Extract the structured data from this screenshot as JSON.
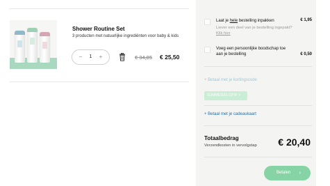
{
  "product": {
    "title": "Shower Routine Set",
    "description": "3 producten met natuurlijke ingrediënten voor baby & kids",
    "quantity": "1",
    "minus_symbol": "−",
    "plus_symbol": "+",
    "old_price": "€ 34,85",
    "new_price": "€ 25,50"
  },
  "summary": {
    "gift_wrap": {
      "title_prefix": "Laat je ",
      "title_emphasis": "hele",
      "title_suffix": " bestelling inpakken",
      "subtitle": "Liever een deel van je bestelling ingepakt? ",
      "subtitle_link": "Klik hier",
      "price": "€ 1,95"
    },
    "personal_message": {
      "title": "Voeg een persoonlijke boodschap toe aan je bestelling",
      "price": "€ 0,50"
    },
    "discount_link": "+ Betaal met je kortingscode",
    "discount_code": "SUMMER20-CPIP ×",
    "gift_card_link": "+ Betaal met je cadeaukaart",
    "total_label": "Totaalbedrag",
    "shipping_note": "Verzendkosten in vervolgstap",
    "total_amount": "€ 20,40",
    "pay_button": "Betalen",
    "pay_chevron": "›"
  },
  "colors": {
    "panel_bg": "#f4f4f2",
    "pay_button": "#86d4a6",
    "gift_link": "#1f6fa8",
    "discount_link": "#9ec7d8"
  }
}
